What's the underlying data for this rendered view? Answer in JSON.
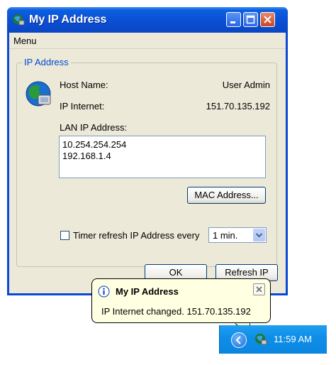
{
  "window": {
    "title": "My IP Address"
  },
  "menu": {
    "item": "Menu"
  },
  "group": {
    "title": "IP Address",
    "host_label": "Host Name:",
    "host_value": "User Admin",
    "ip_label": "IP Internet:",
    "ip_value": "151.70.135.192",
    "lan_label": "LAN IP Address:",
    "lan_line1": "10.254.254.254",
    "lan_line2": "192.168.1.4",
    "mac_button": "MAC Address...",
    "timer_label": "Timer refresh IP Address every",
    "timer_checked": false,
    "timer_value": "1 min."
  },
  "buttons": {
    "ok": "OK",
    "refresh": "Refresh IP"
  },
  "balloon": {
    "title": "My IP Address",
    "message": "IP Internet changed. 151.70.135.192"
  },
  "taskbar": {
    "clock": "11:59 AM"
  },
  "colors": {
    "title_blue": "#0a4fd3",
    "window_bg": "#ece9d8",
    "group_title": "#0046d5",
    "balloon_bg": "#ffffe1",
    "close_red": "#c94520",
    "taskbar_blue": "#0f8ee8"
  },
  "icons": [
    "app-icon",
    "minimize-icon",
    "maximize-icon",
    "close-icon",
    "globe-network-icon",
    "dropdown-arrow-icon",
    "info-icon",
    "balloon-close-icon",
    "tray-chevron-icon",
    "tray-app-icon"
  ]
}
